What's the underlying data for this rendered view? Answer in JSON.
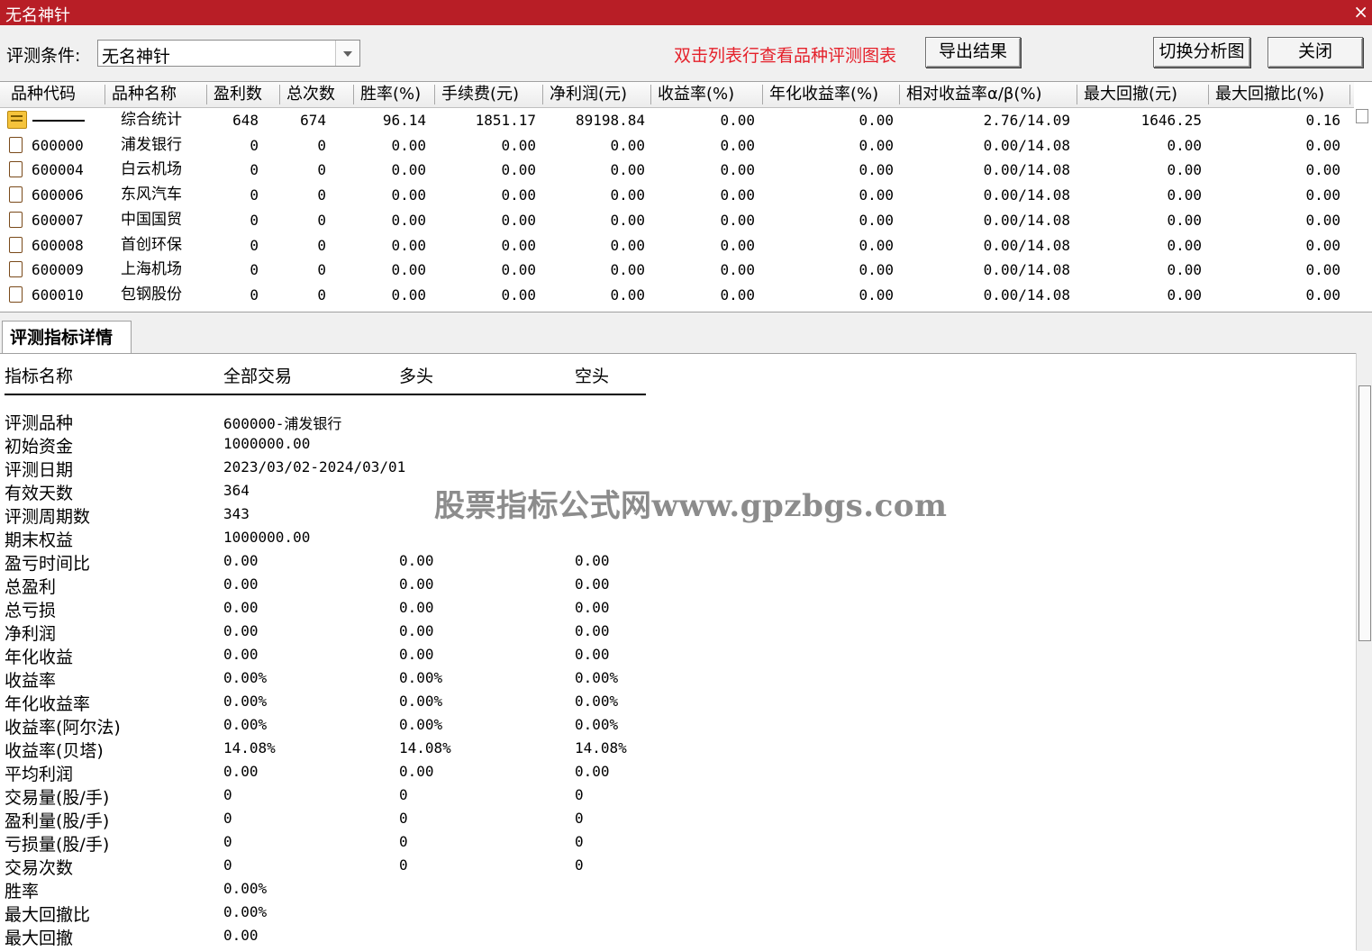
{
  "window": {
    "title": "无名神针",
    "close_glyph": "×"
  },
  "toolbar": {
    "condition_label": "评测条件:",
    "condition_value": "无名神针",
    "hint": "双击列表行查看品种评测图表",
    "export_label": "导出结果",
    "switch_label": "切换分析图",
    "close_label": "关闭",
    "hint_color": "#e5202a"
  },
  "table": {
    "columns": [
      "品种代码",
      "品种名称",
      "盈利数",
      "总次数",
      "胜率(%)",
      "手续费(元)",
      "净利润(元)",
      "收益率(%)",
      "年化收益率(%)",
      "相对收益率α/β(%)",
      "最大回撤(元)",
      "最大回撤比(%)"
    ],
    "rows": [
      {
        "icon": "summary-folder-icon",
        "code": "——————",
        "name": "综合统计",
        "profit_count": "648",
        "total_count": "674",
        "win_rate": "96.14",
        "fee": "1851.17",
        "net_profit": "89198.84",
        "return": "0.00",
        "annual_return": "0.00",
        "relative": "2.76/14.09",
        "max_dd": "1646.25",
        "max_dd_ratio": "0.16"
      },
      {
        "icon": "stock-icon",
        "code": "600000",
        "name": "浦发银行",
        "profit_count": "0",
        "total_count": "0",
        "win_rate": "0.00",
        "fee": "0.00",
        "net_profit": "0.00",
        "return": "0.00",
        "annual_return": "0.00",
        "relative": "0.00/14.08",
        "max_dd": "0.00",
        "max_dd_ratio": "0.00"
      },
      {
        "icon": "stock-icon",
        "code": "600004",
        "name": "白云机场",
        "profit_count": "0",
        "total_count": "0",
        "win_rate": "0.00",
        "fee": "0.00",
        "net_profit": "0.00",
        "return": "0.00",
        "annual_return": "0.00",
        "relative": "0.00/14.08",
        "max_dd": "0.00",
        "max_dd_ratio": "0.00"
      },
      {
        "icon": "stock-icon",
        "code": "600006",
        "name": "东风汽车",
        "profit_count": "0",
        "total_count": "0",
        "win_rate": "0.00",
        "fee": "0.00",
        "net_profit": "0.00",
        "return": "0.00",
        "annual_return": "0.00",
        "relative": "0.00/14.08",
        "max_dd": "0.00",
        "max_dd_ratio": "0.00"
      },
      {
        "icon": "stock-icon",
        "code": "600007",
        "name": "中国国贸",
        "profit_count": "0",
        "total_count": "0",
        "win_rate": "0.00",
        "fee": "0.00",
        "net_profit": "0.00",
        "return": "0.00",
        "annual_return": "0.00",
        "relative": "0.00/14.08",
        "max_dd": "0.00",
        "max_dd_ratio": "0.00"
      },
      {
        "icon": "stock-icon",
        "code": "600008",
        "name": "首创环保",
        "profit_count": "0",
        "total_count": "0",
        "win_rate": "0.00",
        "fee": "0.00",
        "net_profit": "0.00",
        "return": "0.00",
        "annual_return": "0.00",
        "relative": "0.00/14.08",
        "max_dd": "0.00",
        "max_dd_ratio": "0.00"
      },
      {
        "icon": "stock-icon",
        "code": "600009",
        "name": "上海机场",
        "profit_count": "0",
        "total_count": "0",
        "win_rate": "0.00",
        "fee": "0.00",
        "net_profit": "0.00",
        "return": "0.00",
        "annual_return": "0.00",
        "relative": "0.00/14.08",
        "max_dd": "0.00",
        "max_dd_ratio": "0.00"
      },
      {
        "icon": "stock-icon",
        "code": "600010",
        "name": "包钢股份",
        "profit_count": "0",
        "total_count": "0",
        "win_rate": "0.00",
        "fee": "0.00",
        "net_profit": "0.00",
        "return": "0.00",
        "annual_return": "0.00",
        "relative": "0.00/14.08",
        "max_dd": "0.00",
        "max_dd_ratio": "0.00"
      }
    ]
  },
  "detail": {
    "tab_label": "评测指标详情",
    "headers": [
      "指标名称",
      "全部交易",
      "多头",
      "空头"
    ],
    "rows": [
      {
        "label": "评测品种",
        "all": "600000-浦发银行",
        "long": "",
        "short": ""
      },
      {
        "label": "初始资金",
        "all": "1000000.00",
        "long": "",
        "short": ""
      },
      {
        "label": "评测日期",
        "all": "2023/03/02-2024/03/01",
        "long": "",
        "short": ""
      },
      {
        "label": "有效天数",
        "all": "364",
        "long": "",
        "short": ""
      },
      {
        "label": "评测周期数",
        "all": "343",
        "long": "",
        "short": ""
      },
      {
        "label": "期末权益",
        "all": "1000000.00",
        "long": "",
        "short": ""
      },
      {
        "label": "盈亏时间比",
        "all": "0.00",
        "long": "0.00",
        "short": "0.00"
      },
      {
        "label": "总盈利",
        "all": "0.00",
        "long": "0.00",
        "short": "0.00"
      },
      {
        "label": "总亏损",
        "all": "0.00",
        "long": "0.00",
        "short": "0.00"
      },
      {
        "label": "净利润",
        "all": "0.00",
        "long": "0.00",
        "short": "0.00"
      },
      {
        "label": "年化收益",
        "all": "0.00",
        "long": "0.00",
        "short": "0.00"
      },
      {
        "label": "收益率",
        "all": "0.00%",
        "long": "0.00%",
        "short": "0.00%"
      },
      {
        "label": "年化收益率",
        "all": "0.00%",
        "long": "0.00%",
        "short": "0.00%"
      },
      {
        "label": "收益率(阿尔法)",
        "all": "0.00%",
        "long": "0.00%",
        "short": "0.00%"
      },
      {
        "label": "收益率(贝塔)",
        "all": "14.08%",
        "long": "14.08%",
        "short": "14.08%"
      },
      {
        "label": "平均利润",
        "all": "0.00",
        "long": "0.00",
        "short": "0.00"
      },
      {
        "label": "交易量(股/手)",
        "all": "0",
        "long": "0",
        "short": "0"
      },
      {
        "label": "盈利量(股/手)",
        "all": "0",
        "long": "0",
        "short": "0"
      },
      {
        "label": "亏损量(股/手)",
        "all": "0",
        "long": "0",
        "short": "0"
      },
      {
        "label": "交易次数",
        "all": "0",
        "long": "0",
        "short": "0"
      },
      {
        "label": "胜率",
        "all": "0.00%",
        "long": "",
        "short": ""
      },
      {
        "label": "最大回撤比",
        "all": "0.00%",
        "long": "",
        "short": ""
      },
      {
        "label": "最大回撤",
        "all": "0.00",
        "long": "",
        "short": ""
      }
    ],
    "watermark": "股票指标公式网www.gpzbgs.com"
  }
}
